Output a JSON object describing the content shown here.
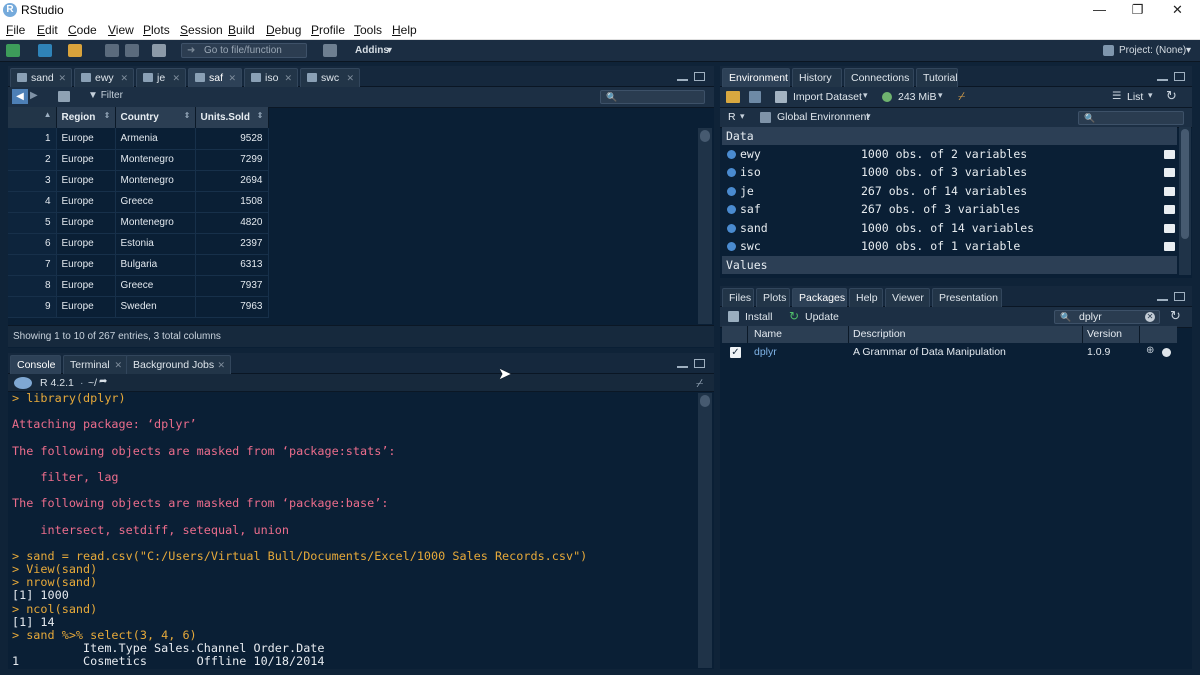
{
  "app": {
    "title": "RStudio",
    "logo_letter": "R"
  },
  "window_controls": {
    "minimize": "—",
    "maximize": "❐",
    "close": "✕"
  },
  "menu": [
    "File",
    "Edit",
    "Code",
    "View",
    "Plots",
    "Session",
    "Build",
    "Debug",
    "Profile",
    "Tools",
    "Help"
  ],
  "toolbar": {
    "goto_placeholder": "Go to file/function",
    "addins": "Addins",
    "project": "Project: (None)"
  },
  "source": {
    "tabs": [
      "sand",
      "ewy",
      "je",
      "saf",
      "iso",
      "swc"
    ],
    "active_tab": "saf",
    "filter_label": "Filter",
    "columns": [
      "Region",
      "Country",
      "Units.Sold"
    ],
    "rows": [
      {
        "n": "1",
        "region": "Europe",
        "country": "Armenia",
        "units": "9528"
      },
      {
        "n": "2",
        "region": "Europe",
        "country": "Montenegro",
        "units": "7299"
      },
      {
        "n": "3",
        "region": "Europe",
        "country": "Montenegro",
        "units": "2694"
      },
      {
        "n": "4",
        "region": "Europe",
        "country": "Greece",
        "units": "1508"
      },
      {
        "n": "5",
        "region": "Europe",
        "country": "Montenegro",
        "units": "4820"
      },
      {
        "n": "6",
        "region": "Europe",
        "country": "Estonia",
        "units": "2397"
      },
      {
        "n": "7",
        "region": "Europe",
        "country": "Bulgaria",
        "units": "6313"
      },
      {
        "n": "8",
        "region": "Europe",
        "country": "Greece",
        "units": "7937"
      },
      {
        "n": "9",
        "region": "Europe",
        "country": "Sweden",
        "units": "7963"
      }
    ],
    "footer": "Showing 1 to 10 of 267 entries, 3 total columns"
  },
  "console": {
    "tabs": [
      "Console",
      "Terminal",
      "Background Jobs"
    ],
    "r_version": "R 4.2.1",
    "path": "~/",
    "lines": [
      {
        "kind": "prompt",
        "text": "> library(dplyr)"
      },
      {
        "kind": "blank",
        "text": " "
      },
      {
        "kind": "msg",
        "text": "Attaching package: ‘dplyr’"
      },
      {
        "kind": "blank",
        "text": " "
      },
      {
        "kind": "msg",
        "text": "The following objects are masked from ‘package:stats’:"
      },
      {
        "kind": "blank",
        "text": " "
      },
      {
        "kind": "msg",
        "text": "    filter, lag"
      },
      {
        "kind": "blank",
        "text": " "
      },
      {
        "kind": "msg",
        "text": "The following objects are masked from ‘package:base’:"
      },
      {
        "kind": "blank",
        "text": " "
      },
      {
        "kind": "msg",
        "text": "    intersect, setdiff, setequal, union"
      },
      {
        "kind": "blank",
        "text": " "
      },
      {
        "kind": "prompt",
        "text": "> sand = read.csv(\"C:/Users/Virtual Bull/Documents/Excel/1000 Sales Records.csv\")"
      },
      {
        "kind": "prompt",
        "text": "> View(sand)"
      },
      {
        "kind": "prompt",
        "text": "> nrow(sand)"
      },
      {
        "kind": "out",
        "text": "[1] 1000"
      },
      {
        "kind": "prompt",
        "text": "> ncol(sand)"
      },
      {
        "kind": "out",
        "text": "[1] 14"
      },
      {
        "kind": "prompt",
        "text": "> sand %>% select(3, 4, 6)"
      },
      {
        "kind": "out",
        "text": "          Item.Type Sales.Channel Order.Date"
      },
      {
        "kind": "out",
        "text": "1         Cosmetics       Offline 10/18/2014"
      }
    ]
  },
  "environment": {
    "tabs": [
      "Environment",
      "History",
      "Connections",
      "Tutorial"
    ],
    "import_label": "Import Dataset",
    "memory": "243 MiB",
    "view_mode": "List",
    "language": "R",
    "scope": "Global Environment",
    "data_header": "Data",
    "values_header": "Values",
    "items": [
      {
        "name": "ewy",
        "desc": "1000 obs. of 2 variables"
      },
      {
        "name": "iso",
        "desc": "1000 obs. of 3 variables"
      },
      {
        "name": "je",
        "desc": "267 obs. of 14 variables"
      },
      {
        "name": "saf",
        "desc": "267 obs. of 3 variables"
      },
      {
        "name": "sand",
        "desc": "1000 obs. of 14 variables"
      },
      {
        "name": "swc",
        "desc": "1000 obs. of 1 variable"
      }
    ]
  },
  "files": {
    "tabs": [
      "Files",
      "Plots",
      "Packages",
      "Help",
      "Viewer",
      "Presentation"
    ],
    "install": "Install",
    "update": "Update",
    "search_value": "dplyr",
    "columns": [
      "Name",
      "Description",
      "Version"
    ],
    "package": {
      "name": "dplyr",
      "description": "A Grammar of Data Manipulation",
      "version": "1.0.9",
      "checked": true
    }
  }
}
